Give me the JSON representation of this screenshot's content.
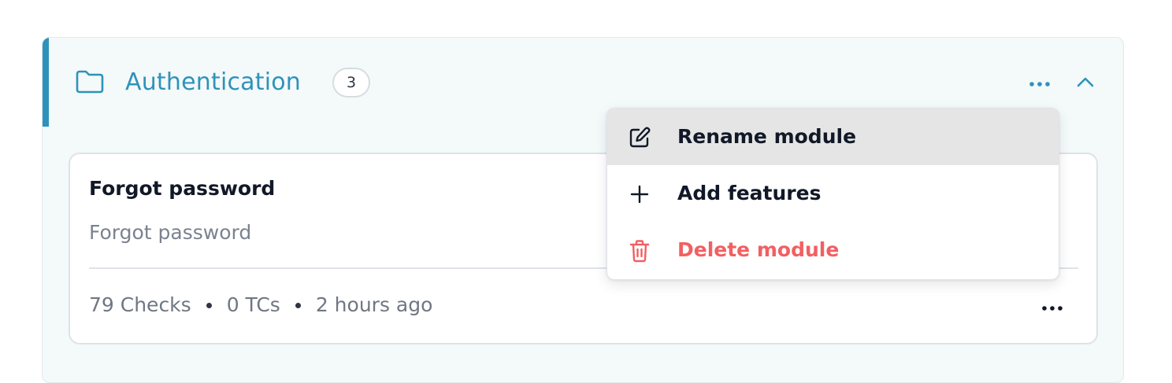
{
  "module": {
    "name": "Authentication",
    "count": "3",
    "accent_color": "#2e93ba",
    "icon": "folder-icon",
    "actions": {
      "more_icon": "more-horizontal-icon",
      "collapse_icon": "chevron-up-icon"
    }
  },
  "feature": {
    "title": "Forgot password",
    "description": "Forgot password",
    "checks": "79 Checks",
    "tcs": "0 TCs",
    "updated": "2 hours ago",
    "more_icon": "more-horizontal-icon"
  },
  "menu": {
    "items": [
      {
        "label": "Rename module",
        "icon": "edit-icon",
        "highlighted": true
      },
      {
        "label": "Add features",
        "icon": "plus-icon",
        "highlighted": false
      },
      {
        "label": "Delete module",
        "icon": "trash-icon",
        "danger": true,
        "danger_color": "#f25f62"
      }
    ]
  }
}
